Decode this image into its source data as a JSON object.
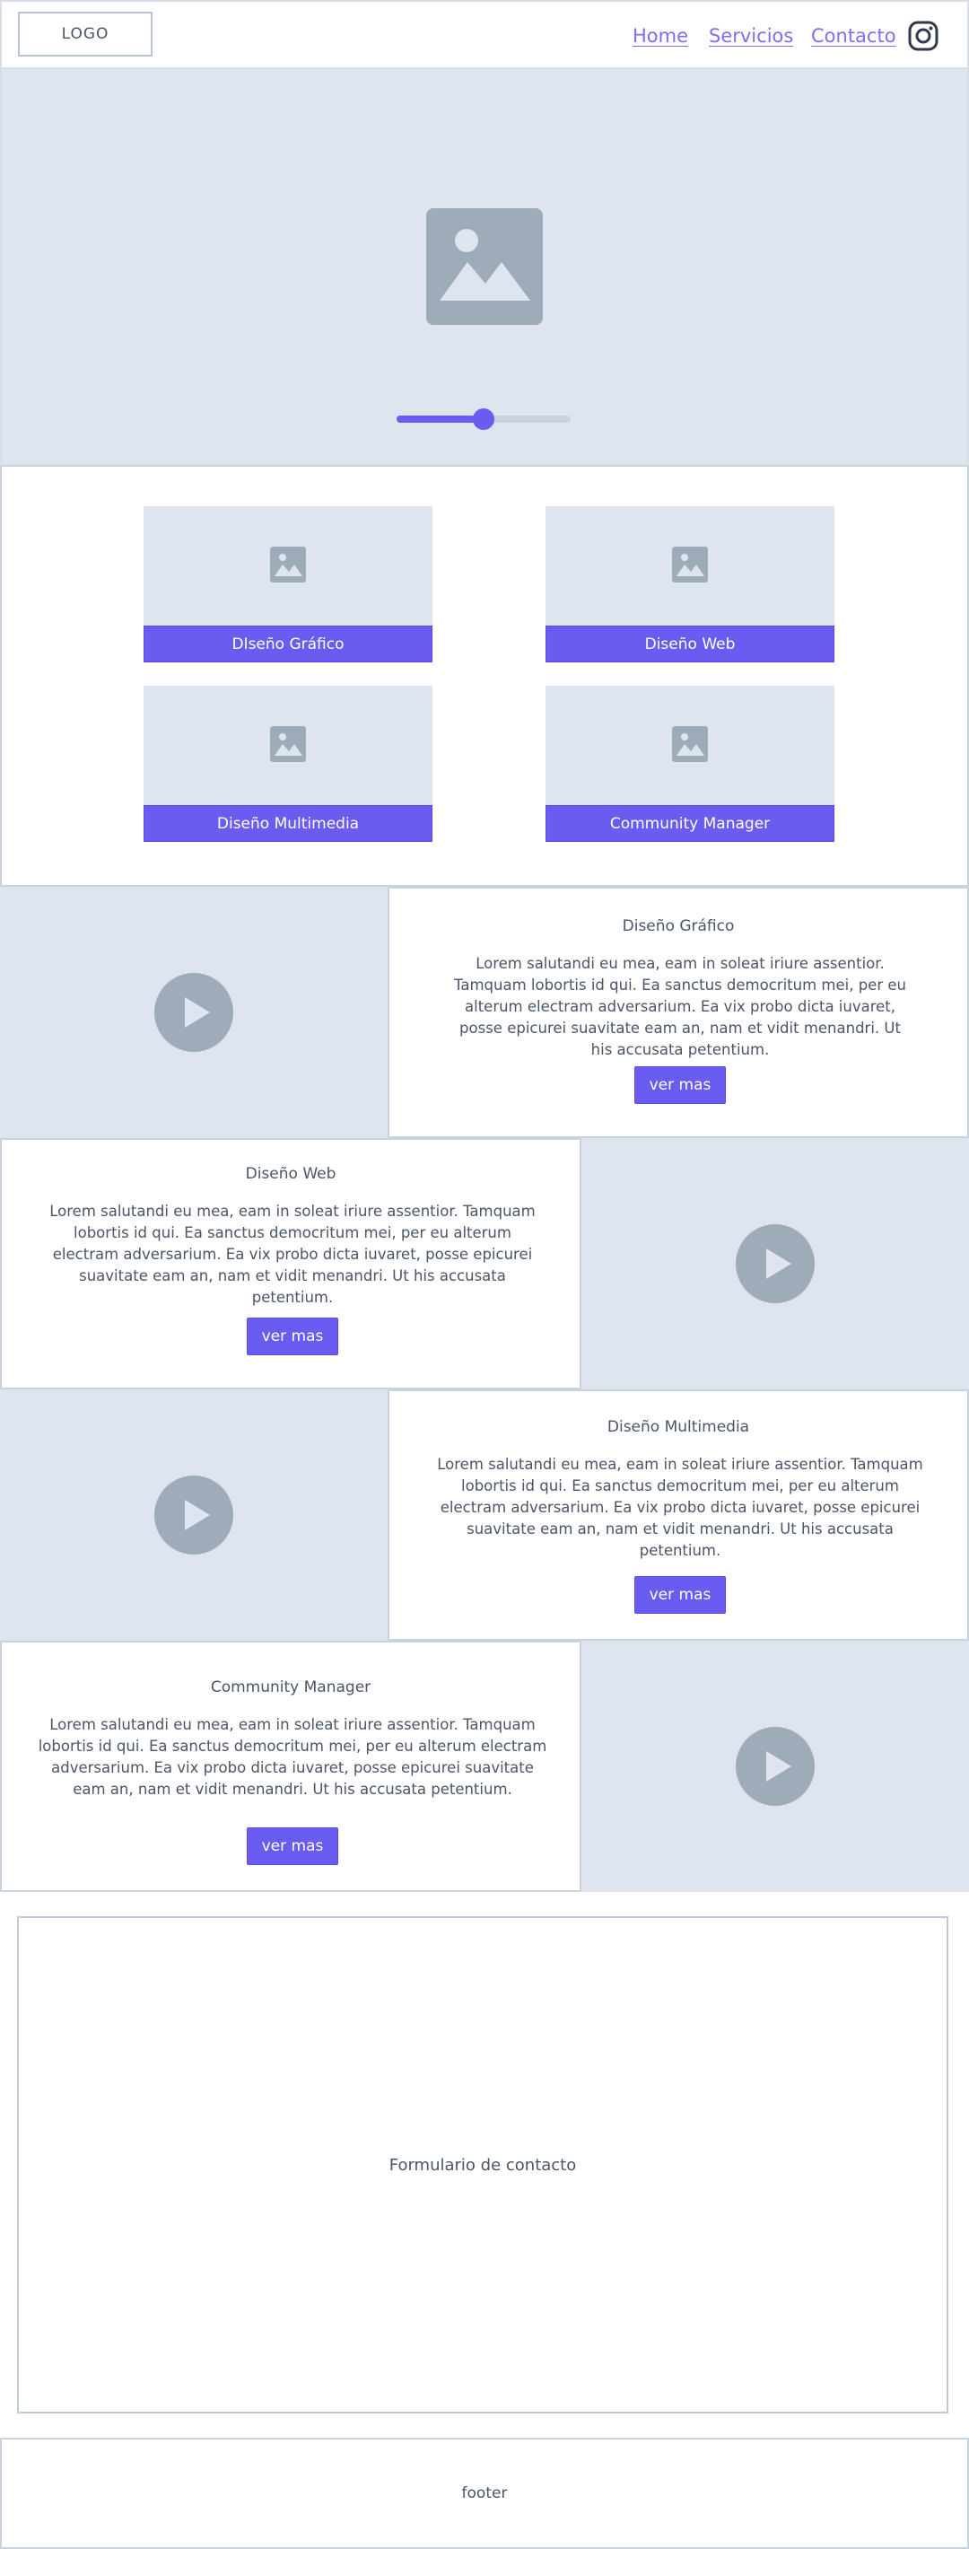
{
  "header": {
    "logo": "LOGO",
    "nav": [
      {
        "label": "Home"
      },
      {
        "label": "Servicios"
      },
      {
        "label": "Contacto"
      }
    ],
    "social_icon": "instagram-icon"
  },
  "hero": {
    "image_icon": "image-placeholder-icon",
    "slider_value": 0.5
  },
  "services": [
    {
      "label": "DIseño Gráfico",
      "icon": "image-placeholder-icon"
    },
    {
      "label": "Diseño Web",
      "icon": "image-placeholder-icon"
    },
    {
      "label": "Diseño Multimedia",
      "icon": "image-placeholder-icon"
    },
    {
      "label": "Community Manager",
      "icon": "image-placeholder-icon"
    }
  ],
  "features": [
    {
      "title": "Diseño Gráfico",
      "body": "Lorem salutandi eu mea, eam in soleat iriure assentior. Tamquam lobortis id qui. Ea sanctus democritum mei, per eu alterum electram adversarium. Ea vix probo dicta iuvaret, posse epicurei suavitate eam an, nam et vidit menandri. Ut his accusata petentium.",
      "button": "ver mas"
    },
    {
      "title": "Diseño Web",
      "body": "Lorem salutandi eu mea, eam in soleat iriure assentior. Tamquam lobortis id qui. Ea sanctus democritum mei, per eu alterum electram adversarium. Ea vix probo dicta iuvaret, posse epicurei suavitate eam an, nam et vidit menandri. Ut his accusata petentium.",
      "button": "ver mas"
    },
    {
      "title": "Diseño Multimedia",
      "body": "Lorem salutandi eu mea, eam in soleat iriure assentior. Tamquam lobortis id qui. Ea sanctus democritum mei, per eu alterum electram adversarium. Ea vix probo dicta iuvaret, posse epicurei suavitate eam an, nam et vidit menandri. Ut his accusata petentium.",
      "button": "ver mas"
    },
    {
      "title": "Community Manager",
      "body": "Lorem salutandi eu mea, eam in soleat iriure assentior. Tamquam lobortis id qui. Ea sanctus democritum mei, per eu alterum electram adversarium. Ea vix probo dicta iuvaret, posse epicurei suavitate eam an, nam et vidit menandri. Ut his accusata petentium.",
      "button": "ver mas"
    }
  ],
  "contact": {
    "label": "Formulario de contacto"
  },
  "footer": {
    "label": "footer"
  },
  "colors": {
    "accent": "#6a5cf0",
    "placeholder": "#dfe5ee",
    "icon": "#9eacb9",
    "border": "#c9d3df"
  }
}
